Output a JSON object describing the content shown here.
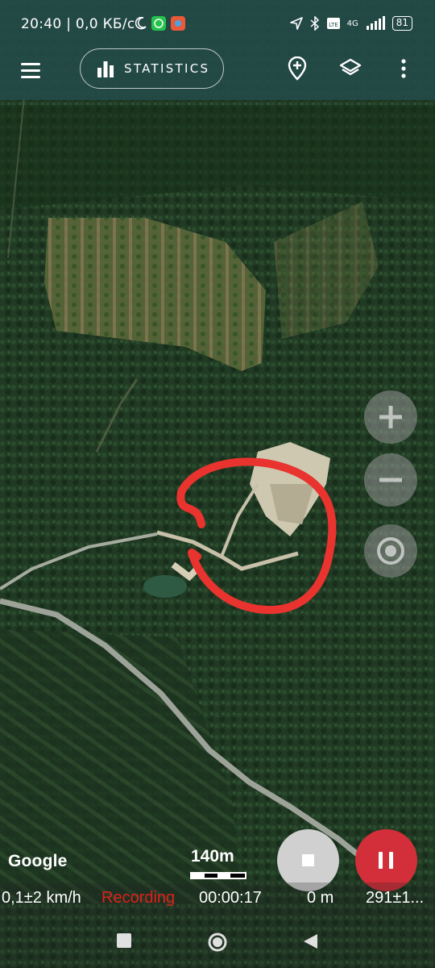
{
  "status_bar": {
    "time": "20:40 | 0,0 КБ/с",
    "network": "4G",
    "battery": "81",
    "icons": [
      "moon-icon",
      "whatsapp-icon",
      "app-icon",
      "location-arrow-icon",
      "bluetooth-icon",
      "volte-icon",
      "signal-icon"
    ]
  },
  "toolbar": {
    "menu_icon": "hamburger-icon",
    "statistics_label": "STATISTICS",
    "statistics_icon": "bar-chart-icon",
    "add_marker_icon": "add-marker-icon",
    "layers_icon": "layers-icon",
    "more_icon": "more-vert-icon"
  },
  "map": {
    "type": "satellite",
    "scale_label": "140m",
    "attribution": "Google",
    "annotation_color": "#e8332e"
  },
  "zoom_controls": {
    "zoom_in_icon": "plus-icon",
    "zoom_out_icon": "minus-icon",
    "location_icon": "my-location-icon"
  },
  "recording_controls": {
    "stop_icon": "stop-icon",
    "pause_icon": "pause-icon",
    "pause_color": "#d32f3a"
  },
  "info_bar": {
    "speed": "0,1±2 km/h",
    "status": "Recording",
    "status_color": "#e0201b",
    "duration": "00:00:17",
    "distance": "0 m",
    "elevation": "291±1..."
  },
  "nav_bar": {
    "recents_icon": "square-icon",
    "home_icon": "circle-icon",
    "back_icon": "triangle-back-icon"
  }
}
